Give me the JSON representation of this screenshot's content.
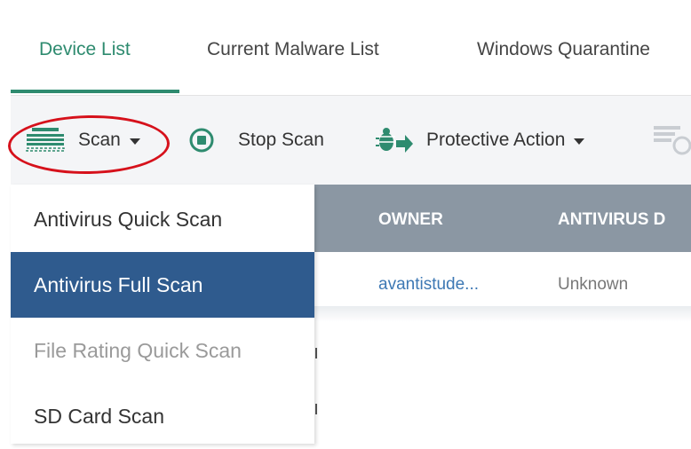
{
  "tabs": [
    {
      "label": "Device List",
      "active": true
    },
    {
      "label": "Current Malware List",
      "active": false
    },
    {
      "label": "Windows Quarantine",
      "active": false
    }
  ],
  "toolbar": {
    "scan_label": "Scan",
    "stop_scan_label": "Stop Scan",
    "protective_action_label": "Protective Action"
  },
  "scan_menu": [
    {
      "label": "Antivirus Quick Scan",
      "state": "normal"
    },
    {
      "label": "Antivirus Full Scan",
      "state": "selected"
    },
    {
      "label": "File Rating Quick Scan",
      "state": "disabled"
    },
    {
      "label": "SD Card Scan",
      "state": "normal"
    }
  ],
  "table": {
    "columns": [
      "OWNER",
      "ANTIVIRUS D"
    ],
    "rows": [
      {
        "owner": "avantistude...",
        "antivirus": "Unknown"
      }
    ]
  },
  "colors": {
    "accent": "#2e8b6f",
    "menu_selected": "#2f5b8e",
    "table_header": "#8b97a3",
    "link": "#3d78b4",
    "highlight_circle": "#d6111b"
  },
  "icons": {
    "scan": "scanner-icon",
    "stop": "stop-circle-icon",
    "protective": "bug-arrow-icon",
    "sync": "sync-icon"
  }
}
